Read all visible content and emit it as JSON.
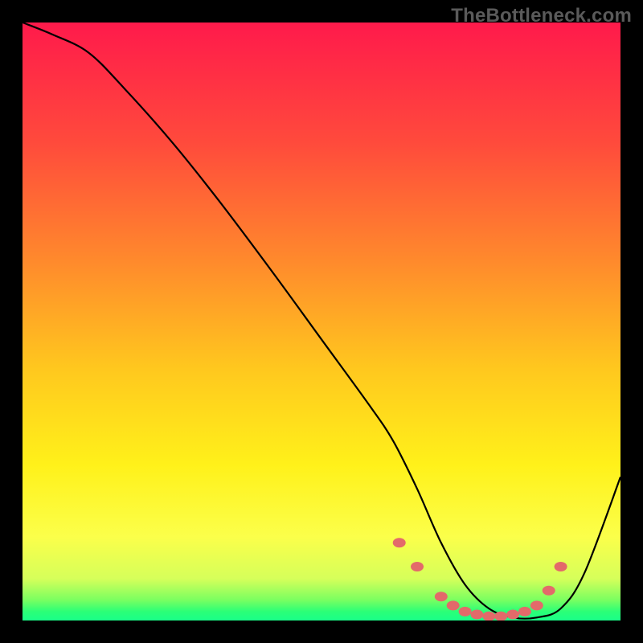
{
  "watermark": "TheBottleneck.com",
  "chart_data": {
    "type": "line",
    "title": "",
    "xlabel": "",
    "ylabel": "",
    "xlim": [
      0,
      100
    ],
    "ylim": [
      0,
      100
    ],
    "gradient_stops": [
      {
        "offset": 0.0,
        "color": "#ff1a4b"
      },
      {
        "offset": 0.2,
        "color": "#ff4a3c"
      },
      {
        "offset": 0.4,
        "color": "#ff8a2c"
      },
      {
        "offset": 0.58,
        "color": "#ffc81e"
      },
      {
        "offset": 0.74,
        "color": "#fff11a"
      },
      {
        "offset": 0.86,
        "color": "#fbff4a"
      },
      {
        "offset": 0.93,
        "color": "#d6ff5a"
      },
      {
        "offset": 0.965,
        "color": "#7cff60"
      },
      {
        "offset": 0.985,
        "color": "#2bff77"
      },
      {
        "offset": 1.0,
        "color": "#1aff88"
      }
    ],
    "series": [
      {
        "name": "bottleneck-curve",
        "x": [
          0,
          5,
          11,
          17,
          25,
          33,
          42,
          50,
          58,
          62,
          66,
          70,
          74,
          78,
          82,
          86,
          90,
          94,
          100
        ],
        "values": [
          100,
          98,
          95,
          89,
          80,
          70,
          58,
          47,
          36,
          30,
          22,
          13,
          6,
          2,
          0.5,
          0.5,
          2,
          8,
          24
        ]
      }
    ],
    "markers": {
      "name": "highlight-points",
      "color": "#e36a6a",
      "x": [
        63,
        66,
        70,
        72,
        74,
        76,
        78,
        80,
        82,
        84,
        86,
        88,
        90
      ],
      "values": [
        13,
        9,
        4,
        2.5,
        1.5,
        1,
        0.7,
        0.7,
        1,
        1.5,
        2.5,
        5,
        9
      ]
    }
  }
}
